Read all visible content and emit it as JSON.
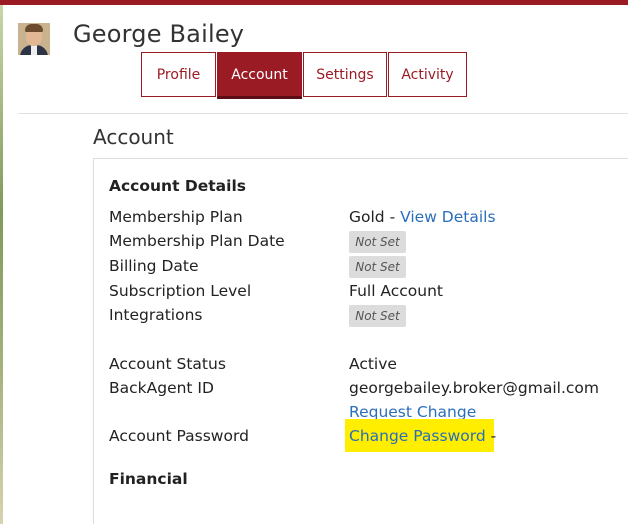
{
  "user": {
    "name": "George Bailey"
  },
  "tabs": [
    {
      "label": "Profile",
      "active": false
    },
    {
      "label": "Account",
      "active": true
    },
    {
      "label": "Settings",
      "active": false
    },
    {
      "label": "Activity",
      "active": false
    }
  ],
  "section_title": "Account",
  "account_details": {
    "heading": "Account Details",
    "membership_plan": {
      "label": "Membership Plan",
      "value": "Gold - ",
      "link": "View Details"
    },
    "membership_plan_date": {
      "label": "Membership Plan Date",
      "value": "Not Set"
    },
    "billing_date": {
      "label": "Billing Date",
      "value": "Not Set"
    },
    "subscription_level": {
      "label": "Subscription Level",
      "value": "Full Account"
    },
    "integrations": {
      "label": "Integrations",
      "value": "Not Set"
    },
    "account_status": {
      "label": "Account Status",
      "value": "Active"
    },
    "backagent_id": {
      "label": "BackAgent ID",
      "value": "georgebailey.broker@gmail.com",
      "link": "Request Change"
    },
    "account_password": {
      "label": "Account Password",
      "link": "Change Password",
      "suffix": " -"
    }
  },
  "financial": {
    "heading": "Financial"
  },
  "colors": {
    "brand": "#9b1b25",
    "link": "#2a6ebb",
    "highlight": "#ffee00"
  }
}
